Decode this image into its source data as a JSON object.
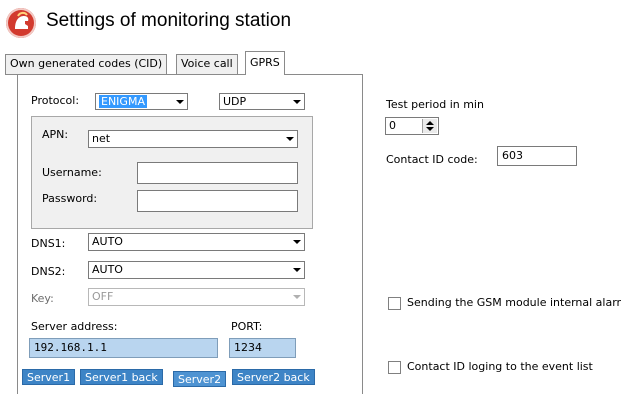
{
  "header": {
    "title": "Settings of monitoring station"
  },
  "tabs": [
    {
      "label": "Own generated codes (CID)",
      "active": false
    },
    {
      "label": "Voice call",
      "active": false
    },
    {
      "label": "GPRS",
      "active": true
    }
  ],
  "gprs": {
    "protocol_label": "Protocol:",
    "protocol_value": "ENIGMA",
    "transport_value": "UDP",
    "apn_label": "APN:",
    "apn_value": "net",
    "username_label": "Username:",
    "username_value": "",
    "password_label": "Password:",
    "password_value": "",
    "dns1_label": "DNS1:",
    "dns1_value": "AUTO",
    "dns2_label": "DNS2:",
    "dns2_value": "AUTO",
    "key_label": "Key:",
    "key_value": "OFF",
    "server_address_label": "Server address:",
    "server_address_value": "192.168.1.1",
    "port_label": "PORT:",
    "port_value": "1234"
  },
  "right": {
    "test_period_label": "Test period in min",
    "test_period_value": "0",
    "contact_id_label": "Contact ID code:",
    "contact_id_value": "603",
    "gsm_alarm_label": "Sending the GSM module internal alarm",
    "gsm_alarm_checked": false,
    "cid_log_label": "Contact ID loging to the event list",
    "cid_log_checked": false
  },
  "server_tabs": [
    {
      "label": "Server1",
      "active": false
    },
    {
      "label": "Server1 back",
      "active": false
    },
    {
      "label": "Server2",
      "active": true
    },
    {
      "label": "Server2 back",
      "active": false
    }
  ],
  "colors": {
    "logo_red": "#d23a2e",
    "field_blue": "#b9d5ef",
    "server_tab_blue": "#3d84c6",
    "selection_blue": "#3399ff"
  }
}
